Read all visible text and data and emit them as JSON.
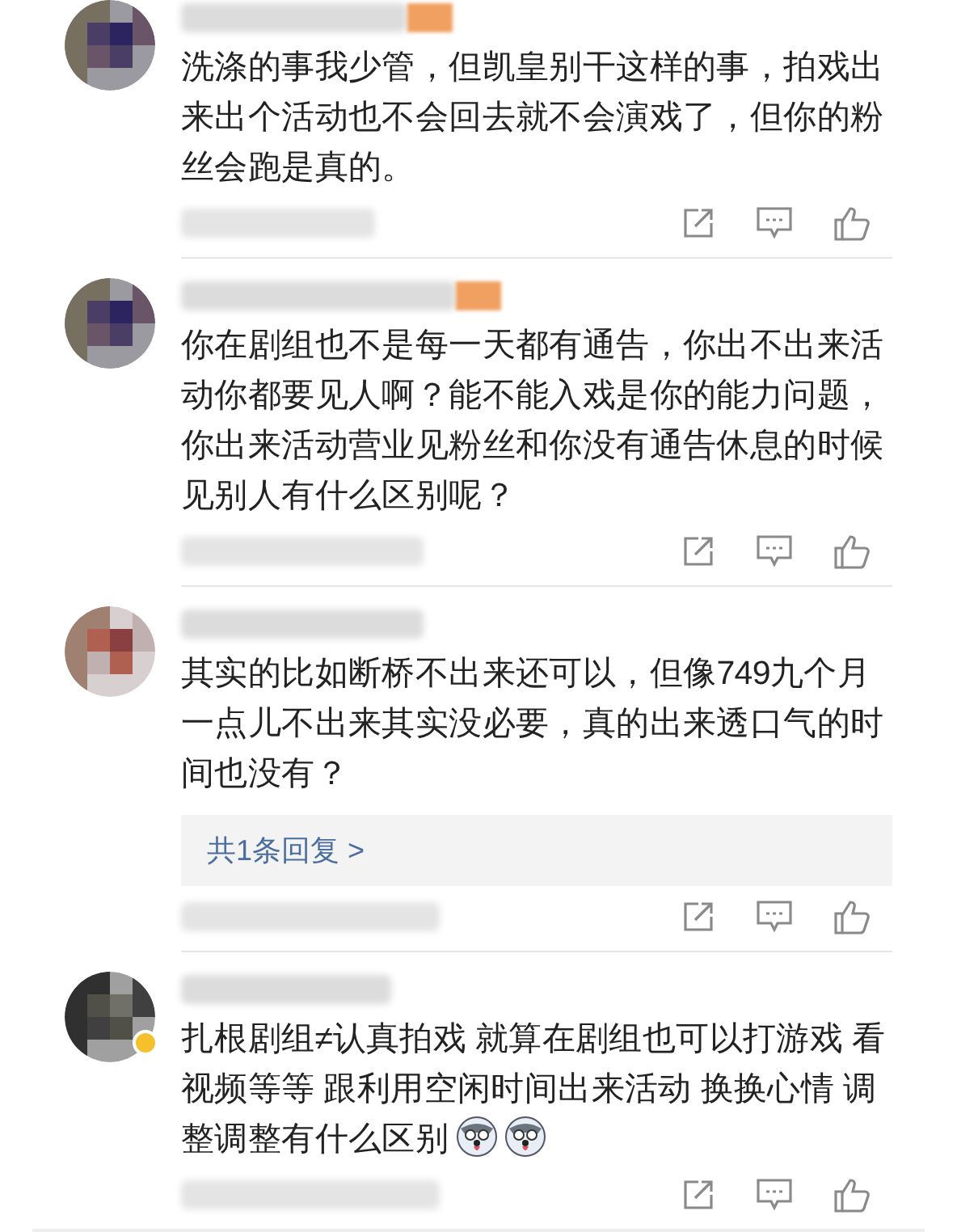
{
  "comments": [
    {
      "badge": true,
      "verified": false,
      "lines": [
        "洗涤的事我少管，但凯皇别干这样的事，拍戏出",
        "来出个活动也不会回去就不会演戏了，但你的粉",
        "丝会跑是真的。"
      ]
    },
    {
      "badge": true,
      "verified": false,
      "lines": [
        "你在剧组也不是每一天都有通告，你出不出来活",
        "动你都要见人啊？能不能入戏是你的能力问题，",
        "你出来活动营业见粉丝和你没有通告休息的时候",
        "见别人有什么区别呢？"
      ]
    },
    {
      "badge": false,
      "verified": false,
      "lines": [
        "其实的比如断桥不出来还可以，但像749九个月",
        "一点儿不出来其实没必要，真的出来透口气的时",
        "间也没有？"
      ],
      "reply_link": "共1条回复 >"
    },
    {
      "badge": false,
      "verified": true,
      "lines": [
        "扎根剧组≠认真拍戏 就算在剧组也可以打游戏 看",
        "视频等等 跟利用空闲时间出来活动 换换心情 调",
        "整调整有什么区别"
      ],
      "emojis": [
        {
          "kind": "dog"
        },
        {
          "kind": "dog"
        }
      ]
    }
  ]
}
